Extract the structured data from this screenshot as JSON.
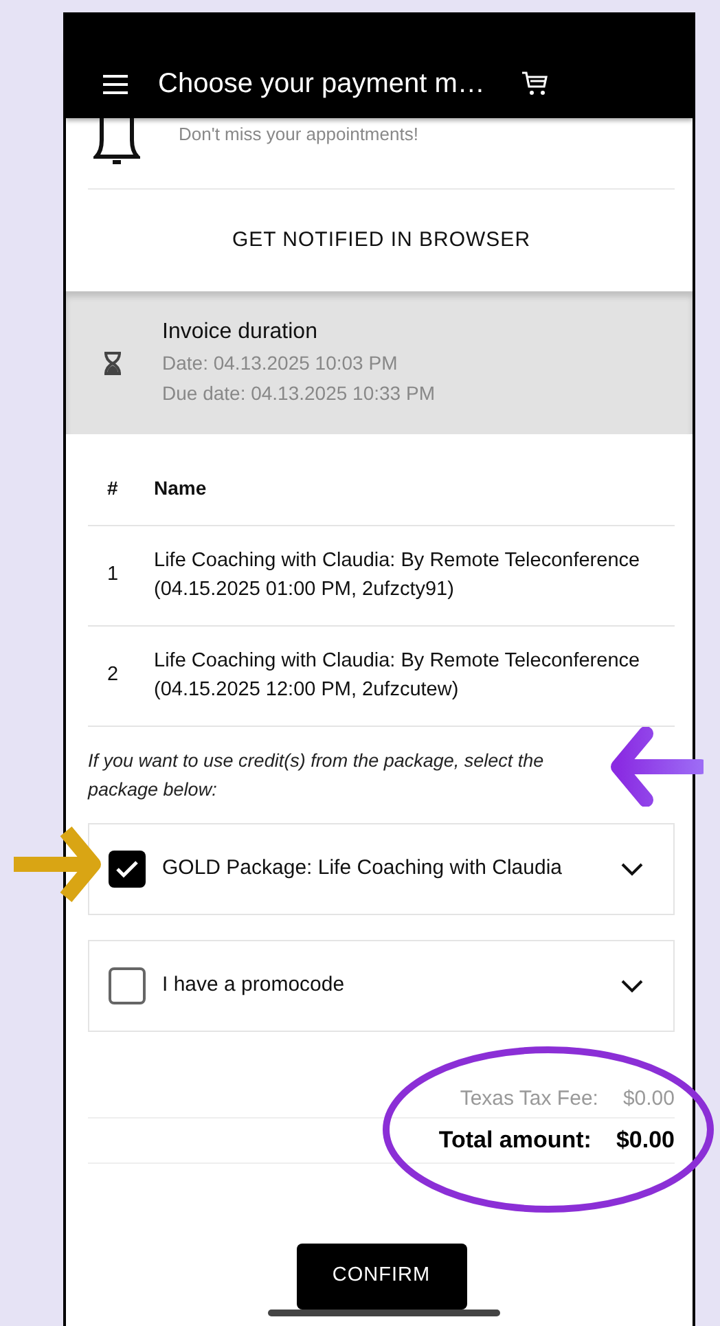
{
  "header": {
    "title": "Choose your payment m…"
  },
  "notification": {
    "text": "Don't miss your appointments!",
    "button": "GET NOTIFIED IN BROWSER"
  },
  "invoice": {
    "title": "Invoice duration",
    "date": "Date: 04.13.2025 10:03 PM",
    "due_date": "Due date: 04.13.2025 10:33 PM"
  },
  "table": {
    "columns": [
      "#",
      "Name"
    ],
    "rows": [
      {
        "number": "1",
        "name": "Life Coaching with Claudia: By Remote Teleconference (04.15.2025 01:00 PM, 2ufzcty91)"
      },
      {
        "number": "2",
        "name": "Life Coaching with Claudia: By Remote Teleconference (04.15.2025 12:00 PM, 2ufzcutew)"
      }
    ]
  },
  "package_hint": "If you want to use credit(s) from the package, select the package below:",
  "options": [
    {
      "label": "GOLD Package: Life Coaching with Claudia",
      "checked": true
    },
    {
      "label": "I have a promocode",
      "checked": false
    }
  ],
  "totals": [
    {
      "label": "Texas Tax Fee:",
      "value": "$0.00",
      "kind": "fee"
    },
    {
      "label": "Total amount:",
      "value": "$0.00",
      "kind": "total"
    }
  ],
  "confirm_button": "CONFIRM"
}
